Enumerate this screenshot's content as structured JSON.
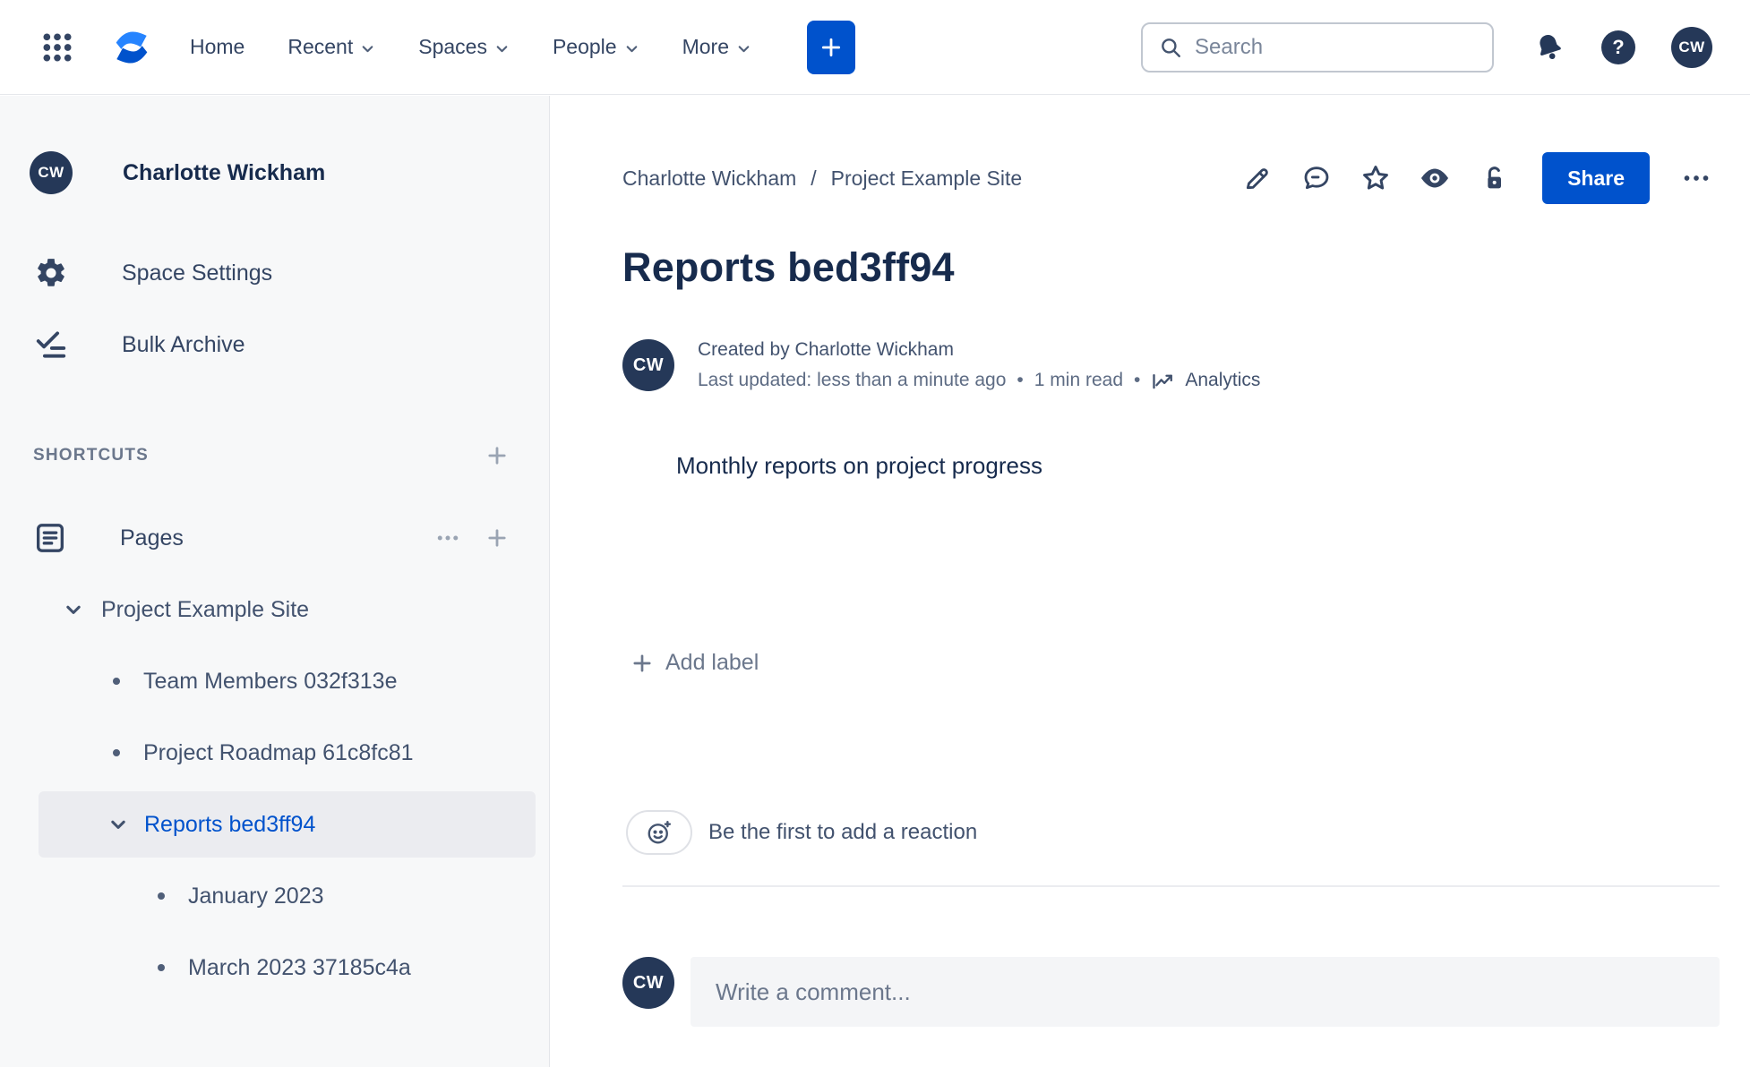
{
  "header": {
    "nav": {
      "home": "Home",
      "recent": "Recent",
      "spaces": "Spaces",
      "people": "People",
      "more": "More"
    },
    "search_placeholder": "Search",
    "avatar_initials": "CW"
  },
  "sidebar": {
    "avatar_initials": "CW",
    "space_name": "Charlotte Wickham",
    "space_settings_label": "Space Settings",
    "bulk_archive_label": "Bulk Archive",
    "shortcuts_label": "SHORTCUTS",
    "pages_label": "Pages",
    "tree": {
      "root_label": "Project Example Site",
      "items": [
        {
          "label": "Team Members 032f313e"
        },
        {
          "label": "Project Roadmap 61c8fc81"
        },
        {
          "label": "Reports bed3ff94",
          "selected": true
        },
        {
          "label": "January 2023"
        },
        {
          "label": "March 2023 37185c4a"
        }
      ]
    }
  },
  "main": {
    "breadcrumb": {
      "crumb1": "Charlotte Wickham",
      "separator": "/",
      "crumb2": "Project Example Site"
    },
    "share_label": "Share",
    "title": "Reports bed3ff94",
    "byline": {
      "avatar_initials": "CW",
      "created": "Created by Charlotte Wickham",
      "updated": "Last updated: less than a minute ago",
      "dot": "•",
      "read_time": "1 min read",
      "analytics_label": "Analytics"
    },
    "body_text": "Monthly reports on project progress",
    "add_label": "Add label",
    "reaction_prompt": "Be the first to add a reaction",
    "comment": {
      "avatar_initials": "CW",
      "placeholder": "Write a comment..."
    }
  },
  "colors": {
    "accent": "#0052CC",
    "logo_blue_light": "#2684FF",
    "avatar_navy": "#253858",
    "selected_bg": "#EBECF0"
  }
}
